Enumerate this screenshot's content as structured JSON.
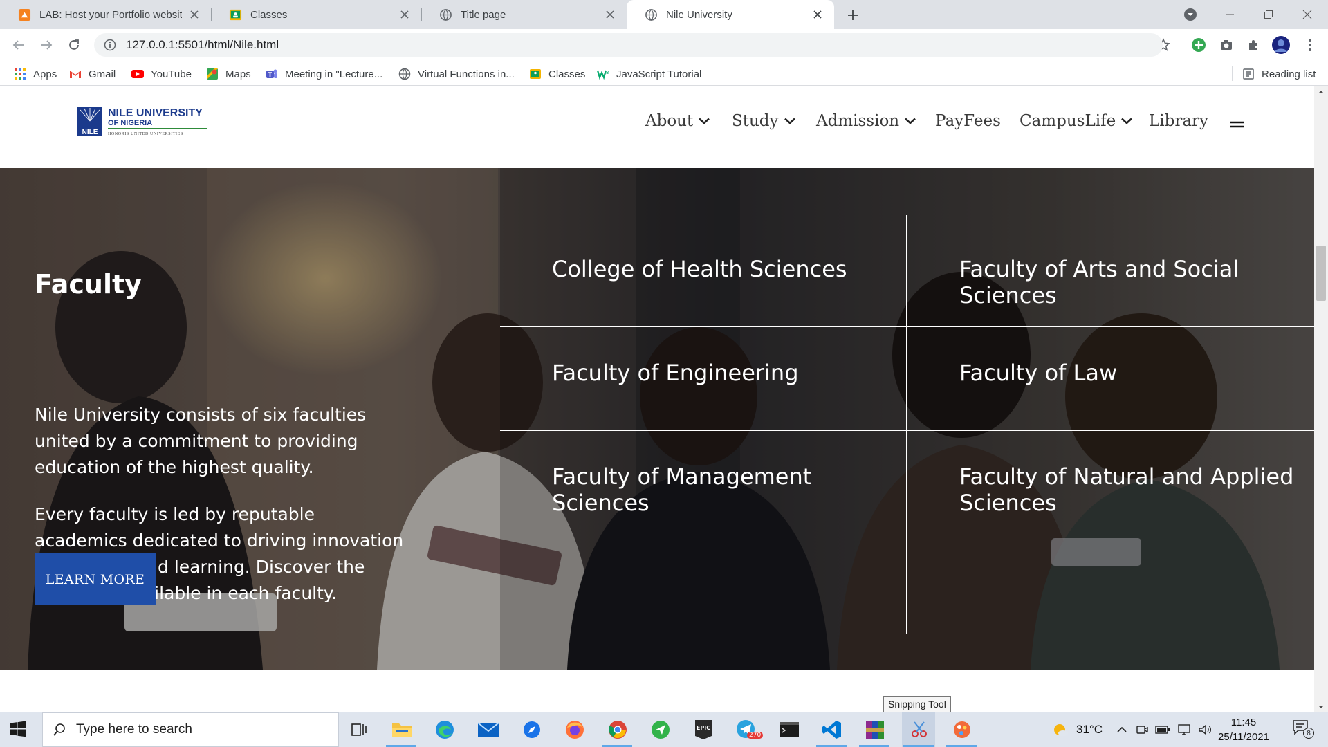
{
  "browser": {
    "tabs": [
      {
        "title": "LAB: Host your Portfolio website",
        "icon": "moodle-favicon-icon",
        "active": false
      },
      {
        "title": "Classes",
        "icon": "google-classroom-icon",
        "active": false
      },
      {
        "title": "Title page",
        "icon": "globe-icon",
        "active": false
      },
      {
        "title": "Nile University",
        "icon": "globe-icon",
        "active": true
      }
    ],
    "address": "127.0.0.1:5501/html/Nile.html",
    "bookmarks": [
      {
        "label": "Apps",
        "icon": "apps-grid-icon"
      },
      {
        "label": "Gmail",
        "icon": "gmail-icon"
      },
      {
        "label": "YouTube",
        "icon": "youtube-icon"
      },
      {
        "label": "Maps",
        "icon": "maps-icon"
      },
      {
        "label": "Meeting in \"Lecture...",
        "icon": "teams-icon"
      },
      {
        "label": "Virtual Functions in...",
        "icon": "globe-icon"
      },
      {
        "label": "Classes",
        "icon": "google-classroom-icon"
      },
      {
        "label": "JavaScript Tutorial",
        "icon": "w3schools-icon"
      }
    ],
    "reading_list": "Reading list"
  },
  "site": {
    "logo": {
      "line1": "NILE UNIVERSITY",
      "line2": "OF NIGERIA",
      "line3": "HONORIS UNITED UNIVERSITIES",
      "badge": "NILE"
    },
    "nav": [
      {
        "label": "About",
        "dropdown": true
      },
      {
        "label": "Study",
        "dropdown": true
      },
      {
        "label": "Admission",
        "dropdown": true
      },
      {
        "label": "PayFees",
        "dropdown": false
      },
      {
        "label": "CampusLife",
        "dropdown": true
      },
      {
        "label": "Library",
        "dropdown": false
      }
    ],
    "hero": {
      "title": "Faculty",
      "paragraph1": "Nile University consists of six faculties united by a commitment to providing education of the highest quality.",
      "paragraph2": "Every faculty is led by reputable academics dedicated to driving innovation in research and learning. Discover the programs available in each faculty.",
      "button": "LEARN MORE"
    },
    "faculties": [
      "College of Health Sciences",
      "Faculty of Arts and Social Sciences",
      "Faculty of Engineering",
      "Faculty of Law",
      "Faculty of Management Sciences",
      "Faculty of Natural and Applied Sciences"
    ]
  },
  "taskbar": {
    "search_placeholder": "Type here to search",
    "tooltip": "Snipping Tool",
    "telegram_badge": "270",
    "weather": "31°C",
    "time": "11:45",
    "date": "25/11/2021",
    "notification_count": "8"
  },
  "colors": {
    "accent": "#1f4ea8",
    "logo_blue": "#1b3a8c",
    "logo_green": "#2e8b3a"
  }
}
